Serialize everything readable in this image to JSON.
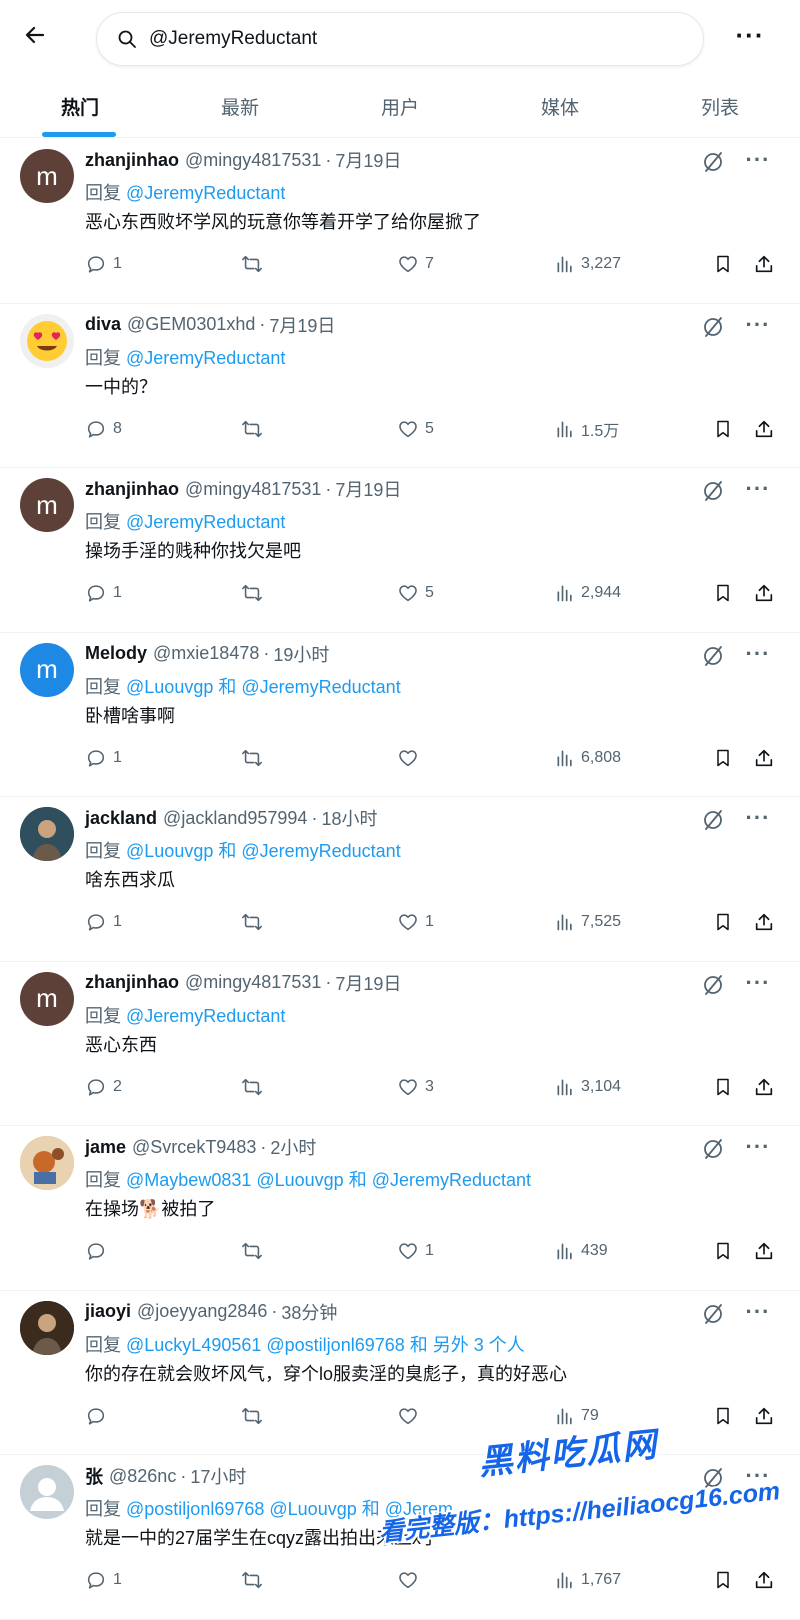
{
  "header": {
    "search_value": "@JeremyReductant",
    "tabs": [
      {
        "label": "热门",
        "active": true
      },
      {
        "label": "最新",
        "active": false
      },
      {
        "label": "用户",
        "active": false
      },
      {
        "label": "媒体",
        "active": false
      },
      {
        "label": "列表",
        "active": false
      }
    ]
  },
  "colors": {
    "accent": "#1d9bf0",
    "text": "#0f1419",
    "muted": "#536471"
  },
  "tweets": [
    {
      "name": "zhanjinhao",
      "handle": "@mingy4817531",
      "sep": "·",
      "time": "7月19日",
      "reply_prefix": "回复",
      "reply_to": "@JeremyReductant",
      "text": "恶心东西败坏学风的玩意你等着开学了给你屋掀了",
      "replies": "1",
      "retweets": "",
      "likes": "7",
      "views": "3,227",
      "avatar_letter": "m",
      "avatar_color": "#5d4037"
    },
    {
      "name": "diva",
      "handle": "@GEM0301xhd",
      "sep": "·",
      "time": "7月19日",
      "reply_prefix": "回复",
      "reply_to": "@JeremyReductant",
      "text": "一中的？",
      "replies": "8",
      "retweets": "",
      "likes": "5",
      "views": "1.5万",
      "avatar_icon": "heart-eyes-emoji-icon"
    },
    {
      "name": "zhanjinhao",
      "handle": "@mingy4817531",
      "sep": "·",
      "time": "7月19日",
      "reply_prefix": "回复",
      "reply_to": "@JeremyReductant",
      "text": "操场手淫的贱种你找欠是吧",
      "replies": "1",
      "retweets": "",
      "likes": "5",
      "views": "2,944",
      "avatar_letter": "m",
      "avatar_color": "#5d4037"
    },
    {
      "name": "Melody",
      "handle": "@mxie18478",
      "sep": "·",
      "time": "19小时",
      "reply_prefix": "回复",
      "reply_to": "@Luouvgp 和 @JeremyReductant",
      "text": "卧槽啥事啊",
      "replies": "1",
      "retweets": "",
      "likes": "",
      "views": "6,808",
      "avatar_letter": "m",
      "avatar_color": "#1e88e5"
    },
    {
      "name": "jackland",
      "handle": "@jackland957994",
      "sep": "·",
      "time": "18小时",
      "reply_prefix": "回复",
      "reply_to": "@Luouvgp 和 @JeremyReductant",
      "text": "啥东西求瓜",
      "replies": "1",
      "retweets": "",
      "likes": "1",
      "views": "7,525",
      "avatar_icon": "photo-avatar-icon",
      "avatar_color": "#2f4f5f"
    },
    {
      "name": "zhanjinhao",
      "handle": "@mingy4817531",
      "sep": "·",
      "time": "7月19日",
      "reply_prefix": "回复",
      "reply_to": "@JeremyReductant",
      "text": "恶心东西",
      "replies": "2",
      "retweets": "",
      "likes": "3",
      "views": "3,104",
      "avatar_letter": "m",
      "avatar_color": "#5d4037"
    },
    {
      "name": "jame",
      "handle": "@SvrcekT9483",
      "sep": "·",
      "time": "2小时",
      "reply_prefix": "回复",
      "reply_to": "@Maybew0831 @Luouvgp 和 @JeremyReductant",
      "text": "在操场🐕被拍了",
      "replies": "",
      "retweets": "",
      "likes": "1",
      "views": "439",
      "avatar_icon": "cartoon-avatar-icon",
      "avatar_color": "#d9b08c"
    },
    {
      "name": "jiaoyi",
      "handle": "@joeyyang2846",
      "sep": "·",
      "time": "38分钟",
      "reply_prefix": "回复",
      "reply_to": "@LuckyL490561 @postiljonl69768 和 另外 3 个人",
      "text": "你的存在就会败坏风气，穿个lo服卖淫的臭彪子，真的好恶心",
      "replies": "",
      "retweets": "",
      "likes": "",
      "views": "79",
      "avatar_icon": "photo-avatar-icon",
      "avatar_color": "#3b2a1e"
    },
    {
      "name": "张",
      "handle": "@826nc",
      "sep": "·",
      "time": "17小时",
      "reply_prefix": "回复",
      "reply_to": "@postiljonl69768 @Luouvgp 和 @Jerem",
      "text": "就是一中的27届学生在cqyz露出拍出来上x了",
      "replies": "1",
      "retweets": "",
      "likes": "",
      "views": "1,767",
      "avatar_icon": "default-user-icon",
      "avatar_color": "#c4cfd6"
    }
  ],
  "watermark": {
    "title": "黑料吃瓜网",
    "subtitle": "看完整版：https://heiliaocg16.com"
  }
}
